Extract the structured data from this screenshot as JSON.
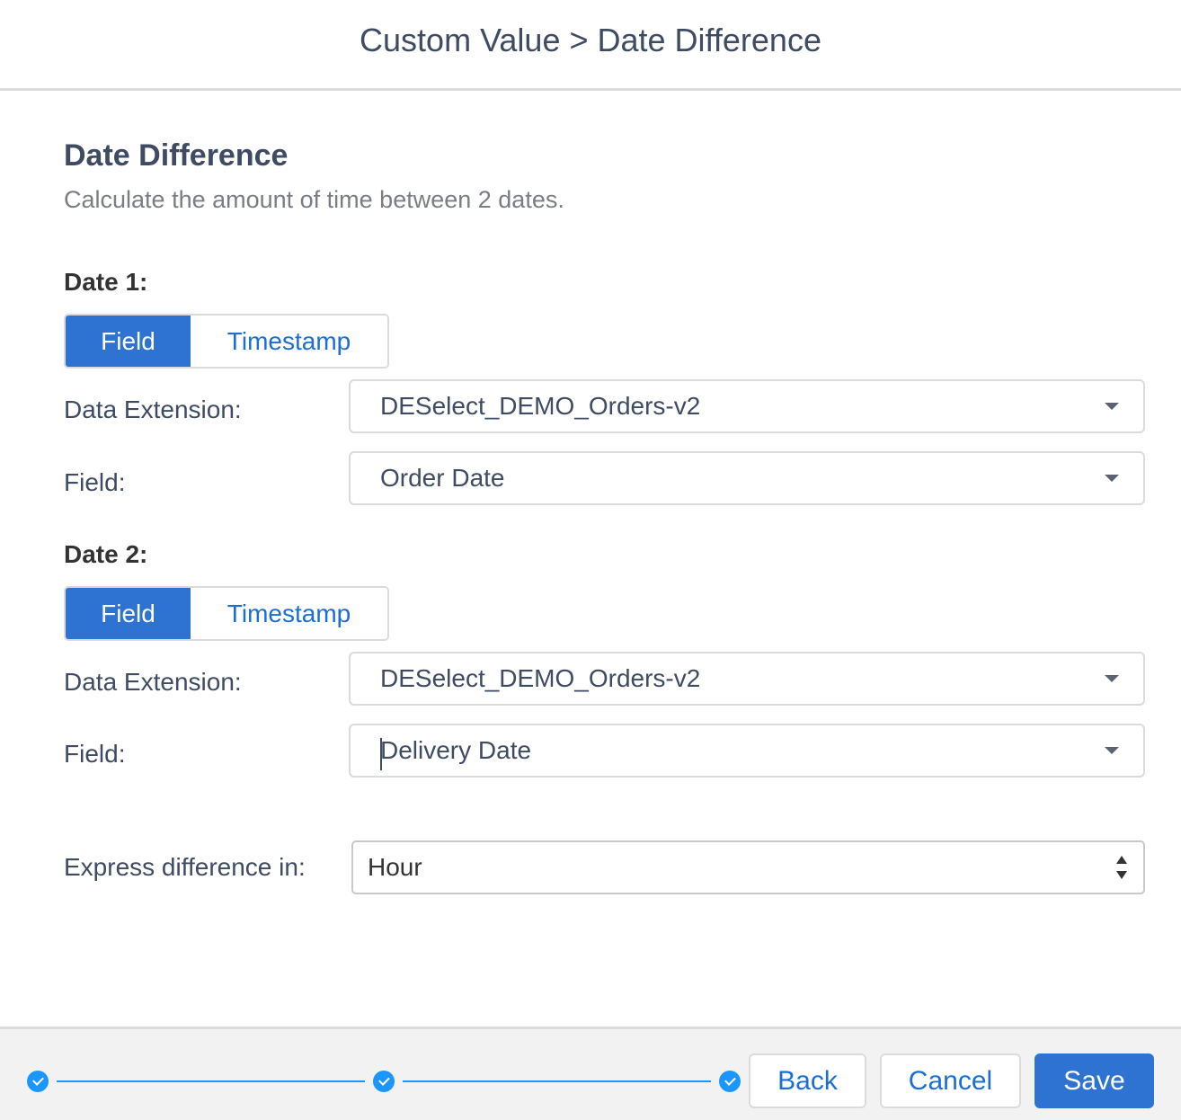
{
  "header": {
    "title": "Custom Value > Date Difference"
  },
  "section": {
    "title": "Date Difference",
    "description": "Calculate the amount of time between 2 dates."
  },
  "date1": {
    "label": "Date 1:",
    "toggle": {
      "options": [
        "Field",
        "Timestamp"
      ],
      "selected": "Field"
    },
    "data_extension_label": "Data Extension:",
    "data_extension_value": "DESelect_DEMO_Orders-v2",
    "field_label": "Field:",
    "field_value": "Order Date"
  },
  "date2": {
    "label": "Date 2:",
    "toggle": {
      "options": [
        "Field",
        "Timestamp"
      ],
      "selected": "Field"
    },
    "data_extension_label": "Data Extension:",
    "data_extension_value": "DESelect_DEMO_Orders-v2",
    "field_label": "Field:",
    "field_value": "Delivery Date"
  },
  "express": {
    "label": "Express difference in:",
    "value": "Hour"
  },
  "footer": {
    "steps_completed": 3,
    "back_label": "Back",
    "cancel_label": "Cancel",
    "save_label": "Save"
  },
  "colors": {
    "brand": "#2e72d2",
    "link": "#1b6ed3",
    "progress": "#1b96ff",
    "text": "#3e4b63"
  },
  "icons": {
    "step": "check-icon",
    "dropdown": "chevron-down-icon",
    "select_spinner": "up-down-arrows-icon"
  }
}
